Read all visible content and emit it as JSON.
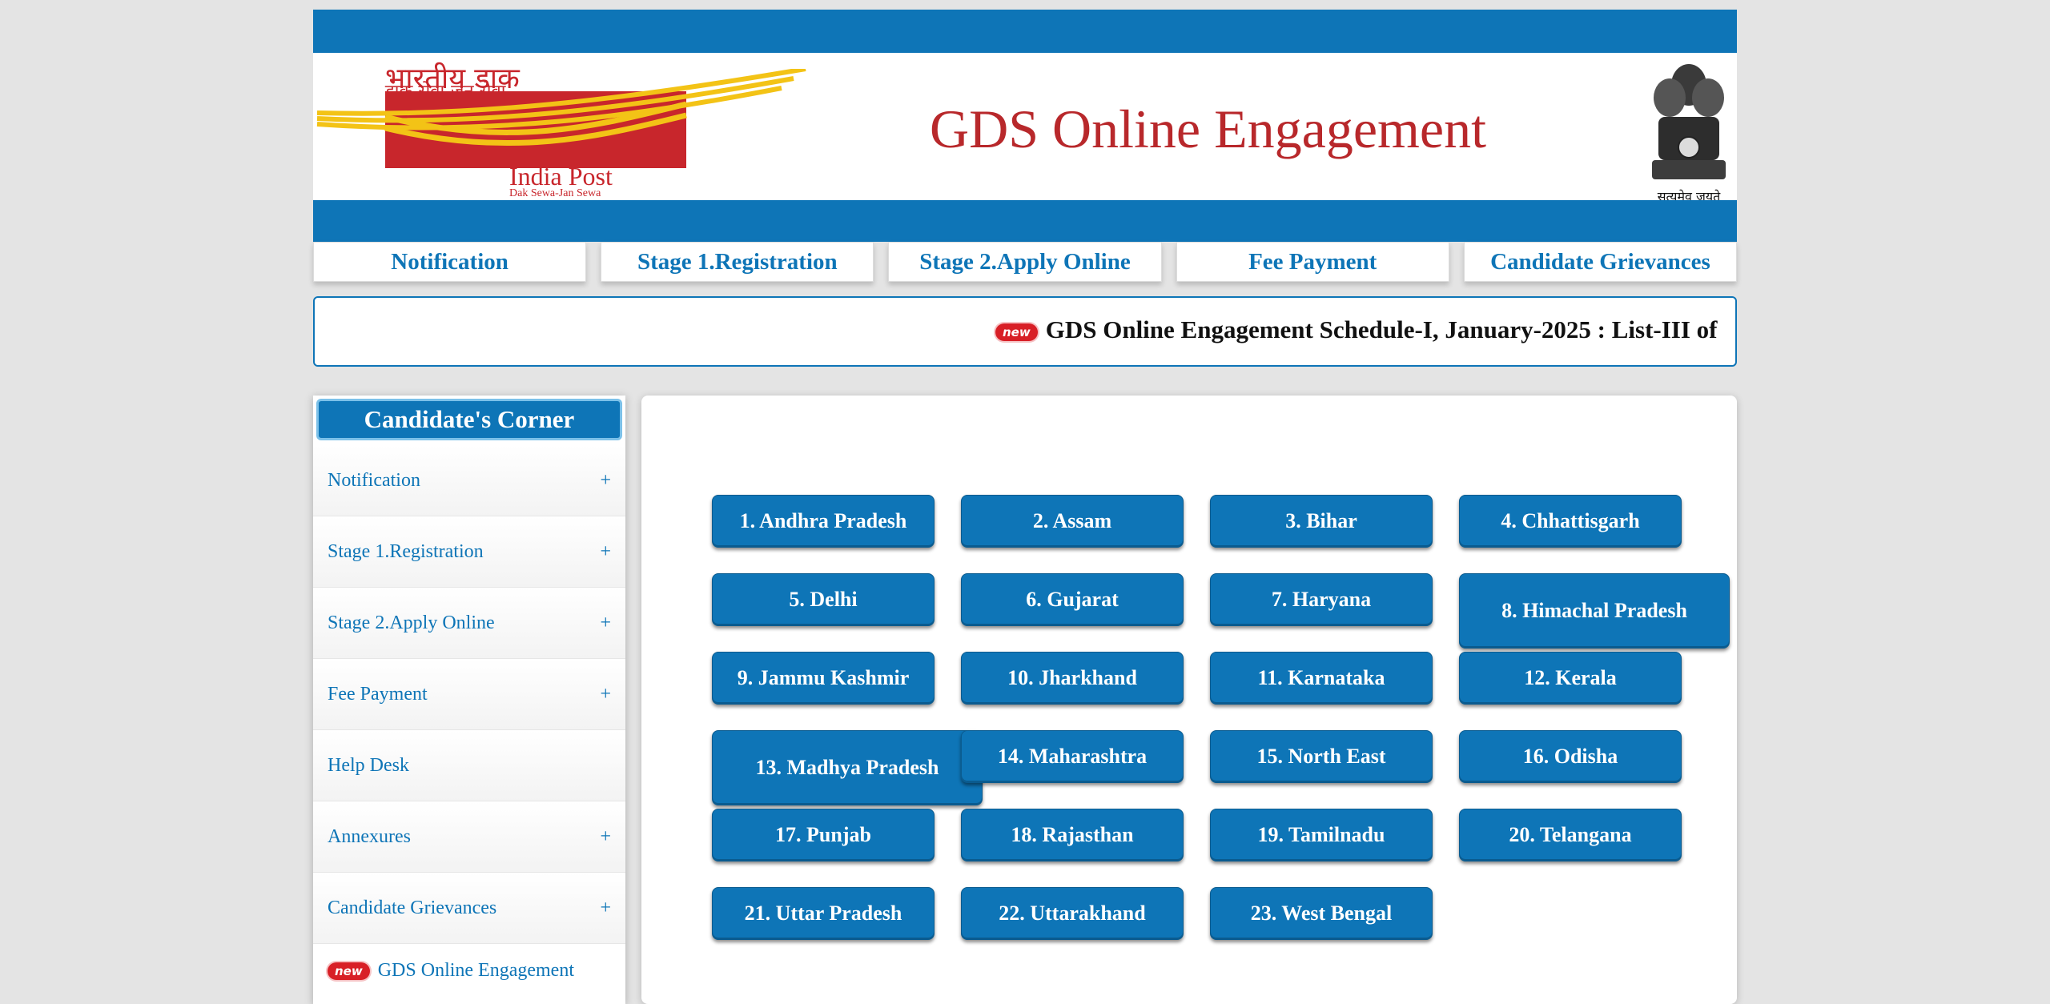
{
  "header": {
    "logo": {
      "hindi_line1": "भारतीय डाक",
      "hindi_line2": "डाक सेवा-जन सेवा",
      "brand": "India Post",
      "tagline": "Dak Sewa-Jan Sewa"
    },
    "title": "GDS Online Engagement",
    "emblem_motto": "सत्यमेव जयते"
  },
  "topnav": [
    {
      "label": "Notification"
    },
    {
      "label": "Stage 1.Registration"
    },
    {
      "label": "Stage 2.Apply Online"
    },
    {
      "label": "Fee Payment"
    },
    {
      "label": "Candidate Grievances"
    }
  ],
  "marquee": {
    "badge": "new",
    "text": "GDS Online Engagement Schedule-I, January-2025 : List-III of"
  },
  "sidebar": {
    "title": "Candidate's Corner",
    "items": [
      {
        "label": "Notification",
        "expand": "+"
      },
      {
        "label": "Stage 1.Registration",
        "expand": "+"
      },
      {
        "label": "Stage 2.Apply Online",
        "expand": "+"
      },
      {
        "label": "Fee Payment",
        "expand": "+"
      },
      {
        "label": "Help Desk",
        "expand": ""
      },
      {
        "label": "Annexures",
        "expand": "+"
      },
      {
        "label": "Candidate Grievances",
        "expand": "+"
      }
    ],
    "last_item": {
      "badge": "new",
      "label": "GDS Online Engagement"
    }
  },
  "states": [
    "1. Andhra Pradesh",
    "2. Assam",
    "3. Bihar",
    "4. Chhattisgarh",
    "5. Delhi",
    "6. Gujarat",
    "7. Haryana",
    "8. Himachal Pradesh",
    "9. Jammu Kashmir",
    "10. Jharkhand",
    "11. Karnataka",
    "12. Kerala",
    "13. Madhya Pradesh",
    "14. Maharashtra",
    "15. North East",
    "16. Odisha",
    "17. Punjab",
    "18. Rajasthan",
    "19. Tamilnadu",
    "20. Telangana",
    "21. Uttar Pradesh",
    "22. Uttarakhand",
    "23. West Bengal"
  ],
  "colors": {
    "primary": "#0e75b7",
    "title_red": "#b8282b",
    "logo_red": "#c8262c",
    "logo_yellow": "#f3c316"
  }
}
